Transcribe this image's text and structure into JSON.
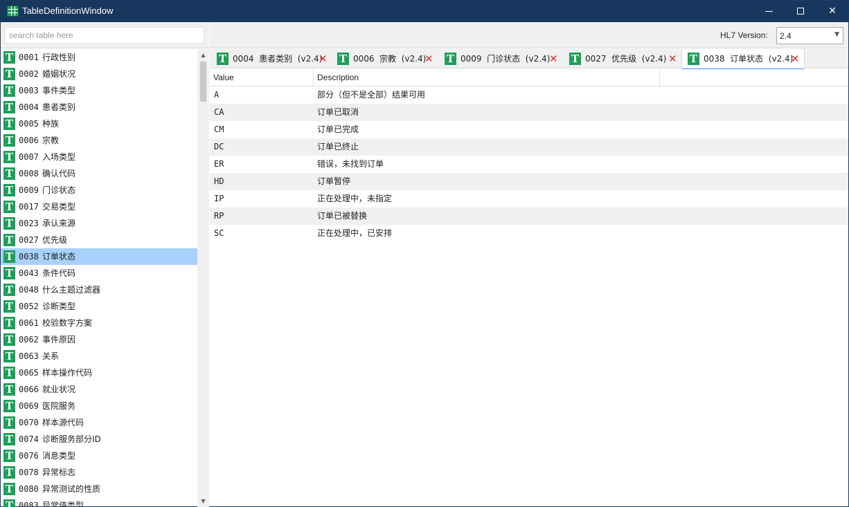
{
  "window": {
    "title": "TableDefinitionWindow",
    "icon": "table-grid-icon",
    "controls": {
      "minimize": "minimize-icon",
      "maximize": "maximize-icon",
      "close": "✕"
    }
  },
  "search": {
    "placeholder": "search table here",
    "value": ""
  },
  "version": {
    "label": "HL7 Version:",
    "selected": "2.4"
  },
  "table_list": {
    "items": [
      {
        "code": "0001",
        "name": "行政性别"
      },
      {
        "code": "0002",
        "name": "婚姻状况"
      },
      {
        "code": "0003",
        "name": "事件类型"
      },
      {
        "code": "0004",
        "name": "患者类别"
      },
      {
        "code": "0005",
        "name": "种族"
      },
      {
        "code": "0006",
        "name": "宗教"
      },
      {
        "code": "0007",
        "name": "入场类型"
      },
      {
        "code": "0008",
        "name": "确认代码"
      },
      {
        "code": "0009",
        "name": "门诊状态"
      },
      {
        "code": "0017",
        "name": "交易类型"
      },
      {
        "code": "0023",
        "name": "承认来源"
      },
      {
        "code": "0027",
        "name": "优先级"
      },
      {
        "code": "0038",
        "name": "订单状态"
      },
      {
        "code": "0043",
        "name": "条件代码"
      },
      {
        "code": "0048",
        "name": "什么主题过滤器"
      },
      {
        "code": "0052",
        "name": "诊断类型"
      },
      {
        "code": "0061",
        "name": "校验数字方案"
      },
      {
        "code": "0062",
        "name": "事件原因"
      },
      {
        "code": "0063",
        "name": "关系"
      },
      {
        "code": "0065",
        "name": "样本操作代码"
      },
      {
        "code": "0066",
        "name": "就业状况"
      },
      {
        "code": "0069",
        "name": "医院服务"
      },
      {
        "code": "0070",
        "name": "样本源代码"
      },
      {
        "code": "0074",
        "name": "诊断服务部分ID"
      },
      {
        "code": "0076",
        "name": "消息类型"
      },
      {
        "code": "0078",
        "name": "异常标志"
      },
      {
        "code": "0080",
        "name": "异常测试的性质"
      },
      {
        "code": "0083",
        "name": "异常值类型"
      }
    ],
    "selected_code": "0038",
    "item_icon": "table-t-icon",
    "icon_letter": "T"
  },
  "tabs": [
    {
      "label": "0004  患者类别  (v2.4)",
      "close": "✕"
    },
    {
      "label": "0006  宗教  (v2.4)",
      "close": "✕"
    },
    {
      "label": "0009  门诊状态  (v2.4)",
      "close": "✕"
    },
    {
      "label": "0027  优先级  (v2.4)",
      "close": "✕"
    },
    {
      "label": "0038  订单状态  (v2.4)",
      "close": "✕"
    }
  ],
  "active_tab": 4,
  "grid": {
    "columns": [
      "Value",
      "Description"
    ],
    "rows": [
      {
        "value": "A",
        "description": "部分（但不是全部）结果可用"
      },
      {
        "value": "CA",
        "description": "订单已取消"
      },
      {
        "value": "CM",
        "description": "订单已完成"
      },
      {
        "value": "DC",
        "description": "订单已终止"
      },
      {
        "value": "ER",
        "description": "错误，未找到订单"
      },
      {
        "value": "HD",
        "description": "订单暂停"
      },
      {
        "value": "IP",
        "description": "正在处理中，未指定"
      },
      {
        "value": "RP",
        "description": "订单已被替换"
      },
      {
        "value": "SC",
        "description": "正在处理中，已安排"
      }
    ]
  },
  "colors": {
    "titlebar": "#17375e",
    "icon_green": "#1f9e5b",
    "selection": "#a8d1fb",
    "close_red": "#e0332b",
    "active_tab_underline": "#3d8ee8",
    "alt_row": "#f0f0f0"
  }
}
